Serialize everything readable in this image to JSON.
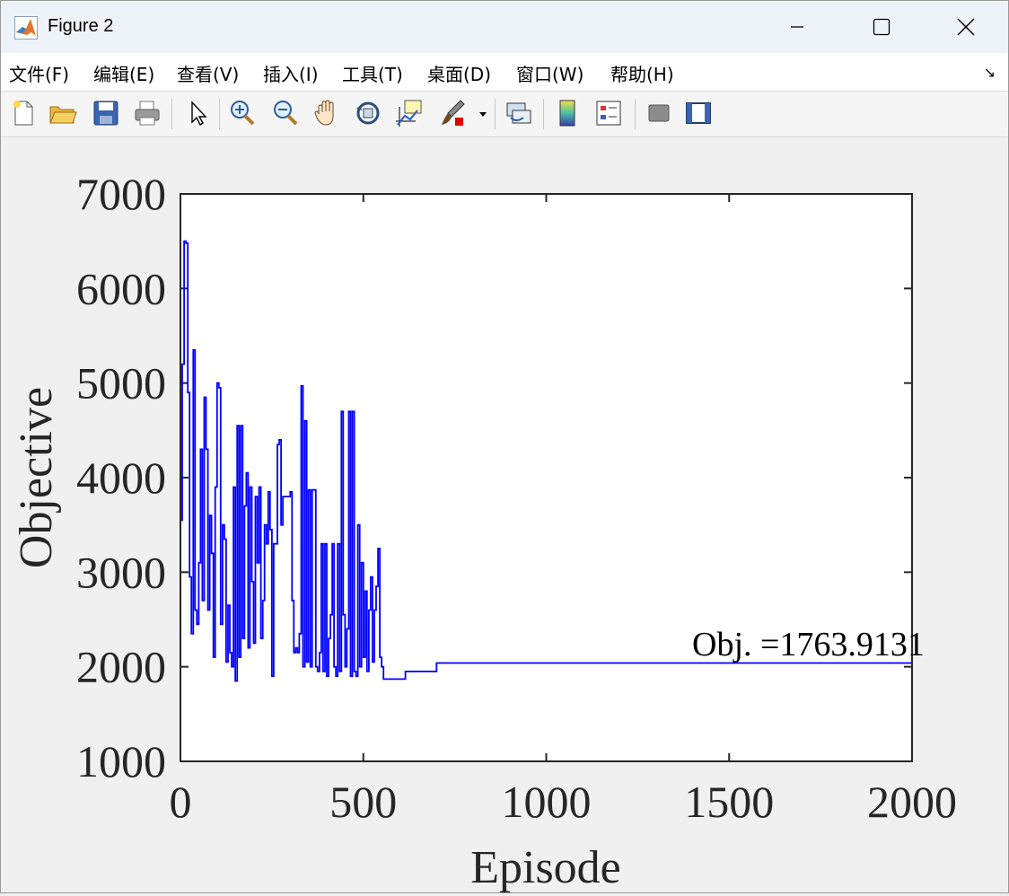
{
  "window": {
    "title": "Figure 2"
  },
  "menu": {
    "items": [
      "文件(F)",
      "编辑(E)",
      "查看(V)",
      "插入(I)",
      "工具(T)",
      "桌面(D)",
      "窗口(W)",
      "帮助(H)"
    ]
  },
  "toolbar": {
    "icons": [
      "new-figure-icon",
      "open-file-icon",
      "save-icon",
      "print-icon",
      "select-arrow-icon",
      "zoom-in-icon",
      "zoom-out-icon",
      "pan-hand-icon",
      "rotate-3d-icon",
      "data-cursor-icon",
      "brush-icon",
      "link-plot-icon",
      "colorbar-icon",
      "legend-icon",
      "hide-plot-tools-icon",
      "show-plot-tools-icon"
    ]
  },
  "chart_data": {
    "type": "line",
    "xlabel": "Episode",
    "ylabel": "Objective",
    "xlim": [
      0,
      2000
    ],
    "ylim": [
      1000,
      7000
    ],
    "xticks": [
      "0",
      "500",
      "1000",
      "1500",
      "2000"
    ],
    "yticks": [
      "1000",
      "2000",
      "3000",
      "4000",
      "5000",
      "6000",
      "7000"
    ],
    "annotation": "Obj. =1763.9131",
    "series": [
      {
        "color": "#0000ff",
        "x": [
          0,
          5,
          10,
          15,
          20,
          25,
          30,
          35,
          40,
          45,
          50,
          55,
          60,
          65,
          70,
          75,
          80,
          85,
          90,
          95,
          100,
          105,
          110,
          115,
          120,
          125,
          130,
          135,
          140,
          145,
          150,
          155,
          160,
          165,
          170,
          175,
          180,
          185,
          190,
          195,
          200,
          205,
          210,
          215,
          220,
          225,
          230,
          235,
          240,
          245,
          250,
          255,
          260,
          265,
          270,
          275,
          280,
          285,
          290,
          295,
          300,
          305,
          310,
          315,
          320,
          325,
          330,
          335,
          340,
          345,
          350,
          355,
          360,
          365,
          370,
          375,
          380,
          385,
          390,
          395,
          400,
          405,
          410,
          415,
          420,
          425,
          430,
          435,
          440,
          445,
          450,
          455,
          460,
          465,
          470,
          475,
          480,
          485,
          490,
          495,
          500,
          505,
          510,
          515,
          520,
          525,
          530,
          535,
          540,
          545,
          550,
          555,
          560,
          600,
          615,
          620,
          690,
          700,
          2000
        ],
        "y": [
          3550,
          5200,
          6500,
          6480,
          4900,
          2950,
          2350,
          5350,
          2600,
          2450,
          3100,
          4300,
          2700,
          4850,
          4300,
          2600,
          3600,
          3200,
          2100,
          3900,
          5000,
          4950,
          2450,
          3500,
          3350,
          2050,
          2650,
          2150,
          2000,
          3900,
          1850,
          4550,
          2100,
          4550,
          2300,
          3700,
          4050,
          2200,
          3900,
          2900,
          2250,
          3800,
          3100,
          3900,
          2300,
          2700,
          3500,
          3300,
          3850,
          3450,
          1900,
          3300,
          3300,
          4350,
          4400,
          3500,
          3800,
          3800,
          3800,
          3800,
          3850,
          2700,
          2150,
          2200,
          2150,
          2350,
          4970,
          2000,
          4600,
          2050,
          3870,
          2000,
          3870,
          3870,
          2000,
          1950,
          2150,
          3300,
          1950,
          3300,
          1900,
          2300,
          2550,
          3300,
          2000,
          1900,
          3300,
          1950,
          4700,
          2550,
          2000,
          2400,
          4700,
          1900,
          4700,
          1950,
          1900,
          3500,
          2000,
          3100,
          2100,
          2800,
          1950,
          2600,
          2950,
          2050,
          2600,
          2850,
          3250,
          2100,
          2000,
          1870,
          1870,
          1870,
          1950,
          1950,
          1950,
          2040,
          2040
        ]
      }
    ]
  }
}
